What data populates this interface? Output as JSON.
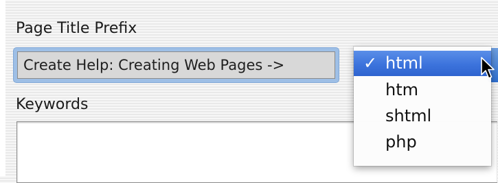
{
  "form": {
    "title_prefix_label": "Page Title Prefix",
    "title_prefix_value": "Create Help: Creating Web Pages ->",
    "keywords_label": "Keywords",
    "keywords_value": ""
  },
  "extension_menu": {
    "check_glyph": "✓",
    "selected_index": 0,
    "items": [
      {
        "label": "html"
      },
      {
        "label": "htm"
      },
      {
        "label": "shtml"
      },
      {
        "label": "php"
      }
    ]
  },
  "icons": {
    "checkmark": "checkmark-icon",
    "cursor": "arrow-cursor-icon"
  },
  "colors": {
    "selection_highlight": "#3c73dc",
    "focus_ring": "#9ebfe6"
  }
}
